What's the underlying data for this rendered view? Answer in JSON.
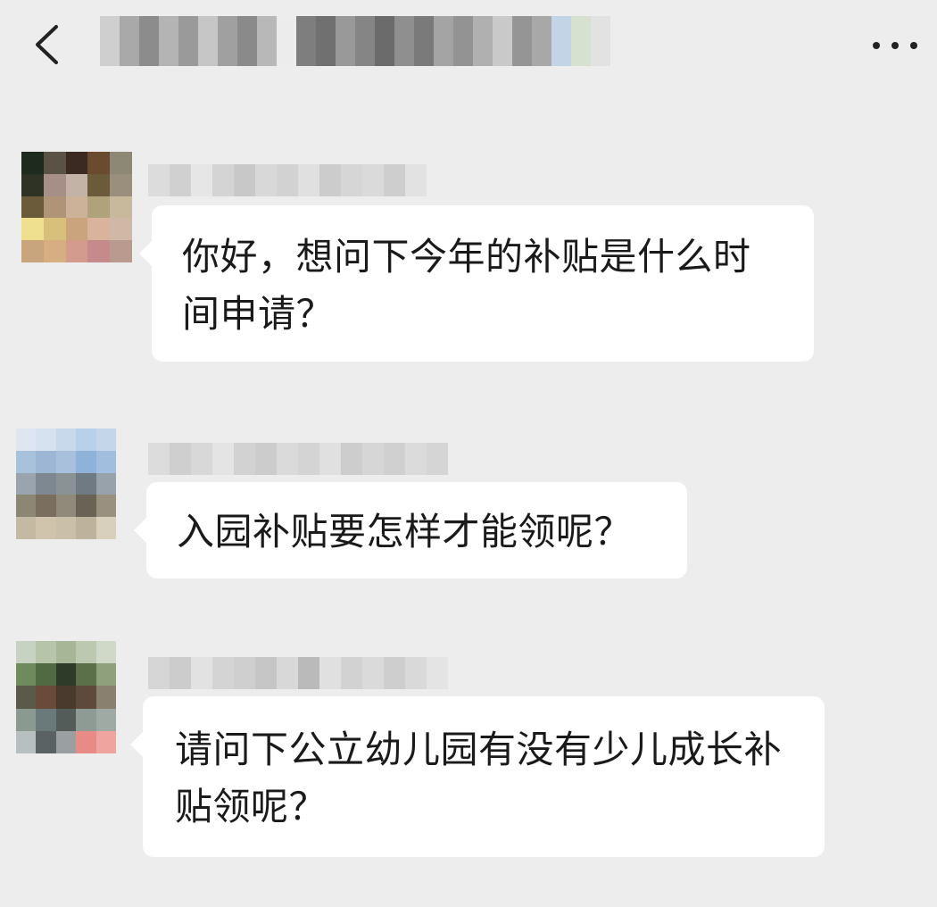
{
  "header": {
    "back_icon": "chevron-left-icon",
    "title": "",
    "more_icon": "ellipsis-icon"
  },
  "messages": [
    {
      "sender": "",
      "text": "你好，想问下今年的补贴是什么时间申请？"
    },
    {
      "sender": "",
      "text": "入园补贴要怎样才能领呢？"
    },
    {
      "sender": "",
      "text": "请问下公立幼儿园有没有少儿成长补贴领呢？"
    }
  ]
}
